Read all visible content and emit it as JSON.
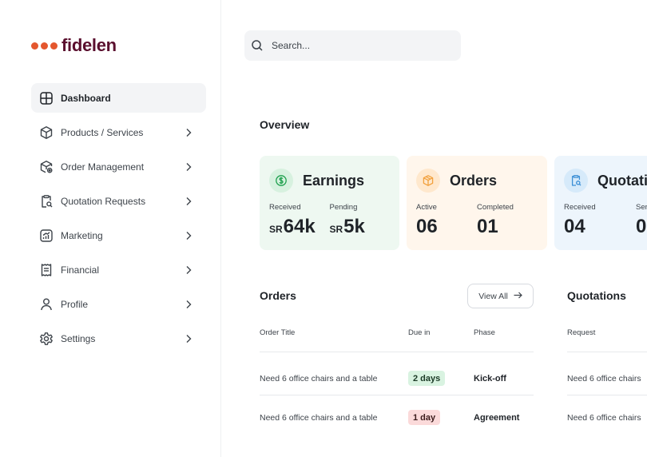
{
  "brand": {
    "name": "fidelen",
    "dot_color": "#e4572e",
    "name_color": "#5a0f2e"
  },
  "search": {
    "placeholder": "Search...",
    "icon": "search-icon"
  },
  "sidebar": {
    "items": [
      {
        "label": "Dashboard",
        "icon": "dashboard-icon",
        "active": true
      },
      {
        "label": "Products / Services",
        "icon": "box-icon"
      },
      {
        "label": "Order Management",
        "icon": "package-settings-icon"
      },
      {
        "label": "Quotation Requests",
        "icon": "clipboard-search-icon"
      },
      {
        "label": "Marketing",
        "icon": "chart-up-icon"
      },
      {
        "label": "Financial",
        "icon": "receipt-icon"
      },
      {
        "label": "Profile",
        "icon": "user-icon"
      },
      {
        "label": "Settings",
        "icon": "gear-icon"
      }
    ]
  },
  "overview": {
    "title": "Overview",
    "cards": [
      {
        "title": "Earnings",
        "icon": "dollar-coin-icon",
        "bg": "#eef8f1",
        "icon_bg": "#d7f1df",
        "accent": "#1fa04e",
        "stats": [
          {
            "label": "Received",
            "currency": "SR",
            "value": "64k"
          },
          {
            "label": "Pending",
            "currency": "SR",
            "value": "5k"
          }
        ]
      },
      {
        "title": "Orders",
        "icon": "box-icon",
        "bg": "#fff6ec",
        "icon_bg": "#ffe8cd",
        "accent": "#f2a03c",
        "stats": [
          {
            "label": "Active",
            "value": "06"
          },
          {
            "label": "Completed",
            "value": "01"
          }
        ]
      },
      {
        "title": "Quotati",
        "icon": "clipboard-search-icon",
        "bg": "#edf5fc",
        "icon_bg": "#d6eafa",
        "accent": "#3b8fd6",
        "stats": [
          {
            "label": "Received",
            "value": "04"
          },
          {
            "label": "Ser",
            "value": "0"
          }
        ]
      }
    ]
  },
  "orders": {
    "title": "Orders",
    "view_all": "View All",
    "columns": [
      "Order Title",
      "Due in",
      "Phase"
    ],
    "rows": [
      {
        "title": "Need 6 office chairs and a table",
        "due": "2 days",
        "due_status": "ok",
        "phase": "Kick-off"
      },
      {
        "title": "Need 6 office chairs and a table",
        "due": "1 day",
        "due_status": "urgent",
        "phase": "Agreement"
      }
    ],
    "badge_colors": {
      "ok_bg": "#d9f3e1",
      "ok_fg": "#1b3a26",
      "urgent_bg": "#fbdada",
      "urgent_fg": "#3a1b1b"
    }
  },
  "quotations": {
    "title": "Quotations",
    "columns": [
      "Request"
    ],
    "rows": [
      {
        "request": "Need 6 office chairs"
      },
      {
        "request": "Need 6 office chairs"
      }
    ]
  }
}
